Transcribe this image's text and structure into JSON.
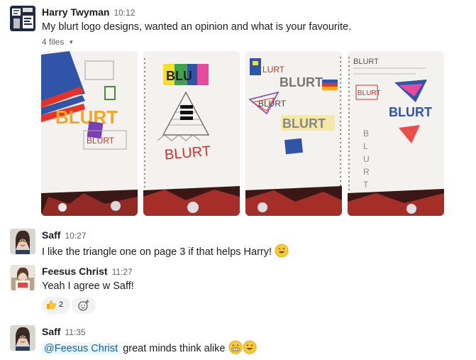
{
  "messages": [
    {
      "author": "Harry Twyman",
      "time": "10:12",
      "text": "My blurt logo designs, wanted an opinion and what is your favourite.",
      "files_label": "4 files"
    },
    {
      "author": "Saff",
      "time": "10:27",
      "text": "I like the triangle one on page 3 if that helps Harry!"
    },
    {
      "author": "Feesus Christ",
      "time": "11:27",
      "text": "Yeah I agree w Saff!",
      "reaction": {
        "emoji_icon": "thumbs-up-icon",
        "count": "2"
      },
      "add_reaction_icon": "add-reaction-icon"
    },
    {
      "author": "Saff",
      "time": "11:35",
      "mention": "@Feesus Christ",
      "text": "great minds think alike"
    }
  ],
  "sketch_text": {
    "blurt": "BLURT",
    "blurt_lower": "BLURT",
    "blut": "BLU"
  },
  "colors": {
    "link": "#1264a3",
    "mention_bg": "#e8f5fa",
    "muted": "#616061"
  }
}
